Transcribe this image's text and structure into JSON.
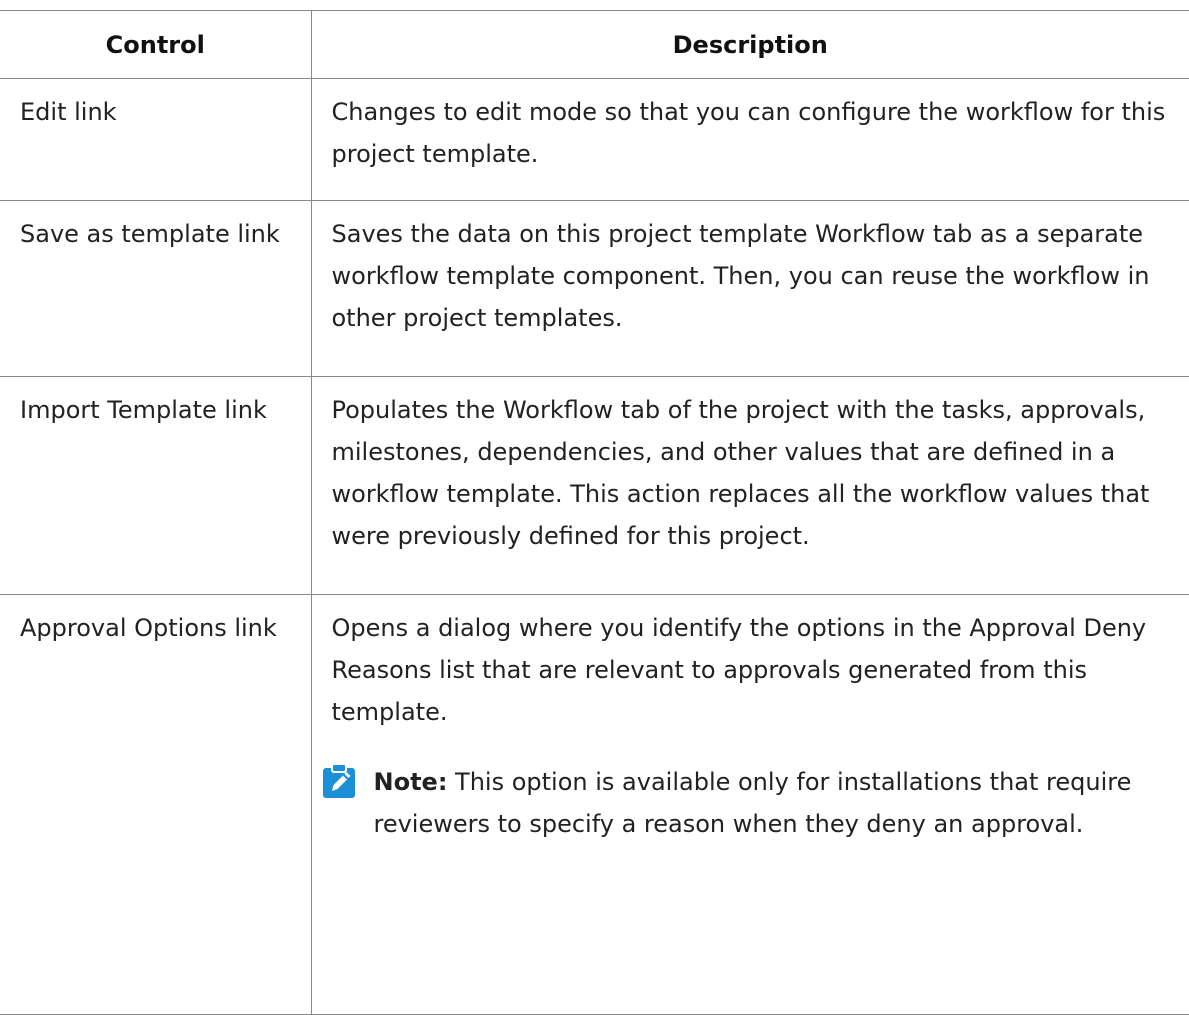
{
  "table": {
    "caption": "",
    "headers": {
      "control": "Control",
      "description": "Description"
    },
    "rows": [
      {
        "control": "Edit link",
        "description": "Changes to edit mode so that you can configure the workflow for this project template."
      },
      {
        "control": "Save as template link",
        "description": "Saves the data on this project template Workflow tab as a separate workflow template component. Then, you can reuse the workflow in other project templates."
      },
      {
        "control": "Import Template link",
        "description": "Populates the Workflow tab of the project with the tasks, approvals, milestones, dependencies, and other values that are defined in a workflow template. This action replaces all the workflow values that were previously defined for this project."
      },
      {
        "control": "Approval Options link",
        "description": "Opens a dialog where you identify the options in the Approval Deny Reasons list that are relevant to approvals generated from this template.",
        "note": {
          "label": "Note:",
          "text": " This option is available only for installations that require reviewers to specify a reason when they deny an approval.",
          "icon": "pencil-note-icon",
          "icon_color": "#1c8fd6"
        }
      }
    ]
  }
}
